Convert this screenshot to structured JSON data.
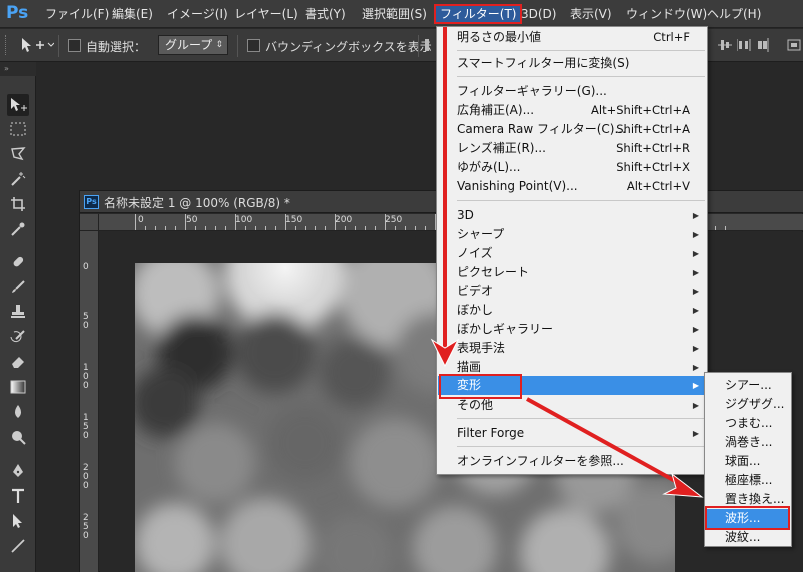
{
  "menubar": {
    "logo": "Ps",
    "items": [
      "ファイル(F)",
      "編集(E)",
      "イメージ(I)",
      "レイヤー(L)",
      "書式(Y)",
      "選択範囲(S)",
      "フィルター(T)",
      "3D(D)",
      "表示(V)",
      "ウィンドウ(W)",
      "ヘルプ(H)"
    ],
    "active": "フィルター(T)"
  },
  "options": {
    "auto_select_label": "自動選択：",
    "auto_select_value": "グループ",
    "bounding_box_label": "バウンディングボックスを表示"
  },
  "document": {
    "ps_badge": "Ps",
    "title": "名称未設定 1 @ 100% (RGB/8) *",
    "ruler_top": [
      "0",
      "50",
      "100",
      "150",
      "200",
      "250"
    ],
    "ruler_left": [
      [
        "0"
      ],
      [
        "5",
        "0"
      ],
      [
        "1",
        "0",
        "0"
      ],
      [
        "1",
        "5",
        "0"
      ],
      [
        "2",
        "0",
        "0"
      ],
      [
        "2",
        "5",
        "0"
      ]
    ]
  },
  "filter_menu": {
    "items": [
      {
        "label": "明るさの最小値",
        "shortcut": "Ctrl+F"
      },
      {
        "label": "スマートフィルター用に変換(S)",
        "shortcut": ""
      },
      {
        "label": "フィルターギャラリー(G)...",
        "shortcut": ""
      },
      {
        "label": "広角補正(A)...",
        "shortcut": "Alt+Shift+Ctrl+A"
      },
      {
        "label": "Camera Raw フィルター(C)...",
        "shortcut": "Shift+Ctrl+A"
      },
      {
        "label": "レンズ補正(R)...",
        "shortcut": "Shift+Ctrl+R"
      },
      {
        "label": "ゆがみ(L)...",
        "shortcut": "Shift+Ctrl+X"
      },
      {
        "label": "Vanishing Point(V)...",
        "shortcut": "Alt+Ctrl+V"
      },
      {
        "label": "3D",
        "shortcut": ""
      },
      {
        "label": "シャープ",
        "shortcut": ""
      },
      {
        "label": "ノイズ",
        "shortcut": ""
      },
      {
        "label": "ピクセレート",
        "shortcut": ""
      },
      {
        "label": "ビデオ",
        "shortcut": ""
      },
      {
        "label": "ぼかし",
        "shortcut": ""
      },
      {
        "label": "ぼかしギャラリー",
        "shortcut": ""
      },
      {
        "label": "表現手法",
        "shortcut": ""
      },
      {
        "label": "描画",
        "shortcut": ""
      },
      {
        "label": "変形",
        "shortcut": ""
      },
      {
        "label": "その他",
        "shortcut": ""
      },
      {
        "label": "Filter Forge",
        "shortcut": ""
      },
      {
        "label": "オンラインフィルターを参照...",
        "shortcut": ""
      }
    ],
    "highlighted": "変形",
    "submenu_arrow": "▶"
  },
  "distort_submenu": {
    "items": [
      "シアー...",
      "ジグザグ...",
      "つまむ...",
      "渦巻き...",
      "球面...",
      "極座標...",
      "置き換え...",
      "波形...",
      "波紋..."
    ],
    "highlighted": "波形..."
  },
  "colors": {
    "highlight": "#3a8fe6",
    "annotation_red": "#e02020",
    "ps_blue": "#4aa3f5"
  }
}
